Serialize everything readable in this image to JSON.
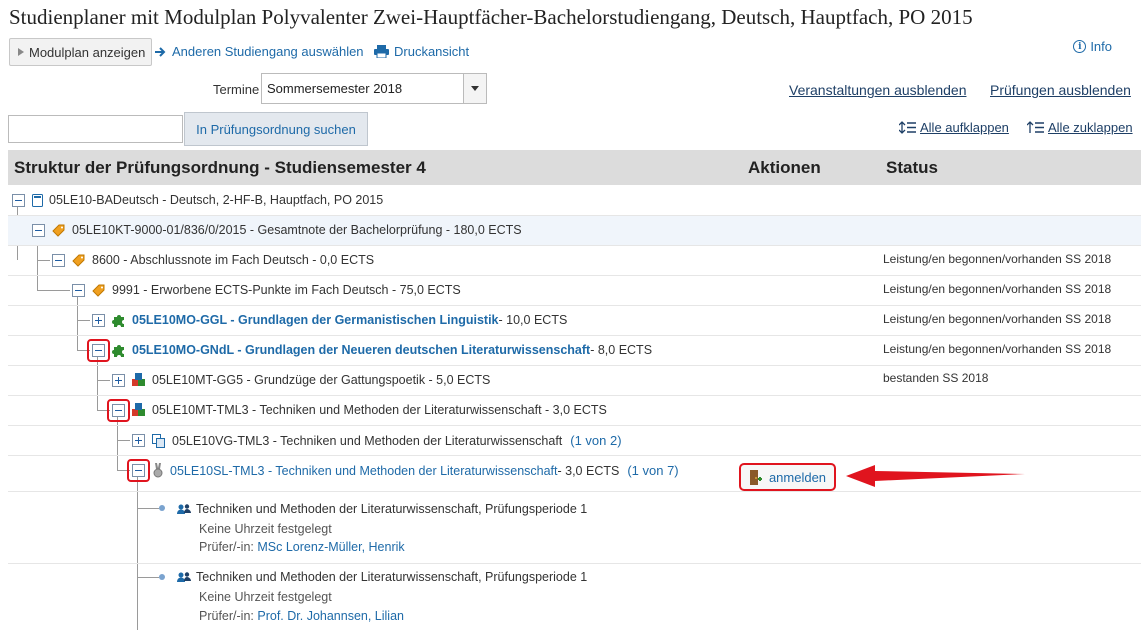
{
  "page_title": "Studienplaner mit Modulplan Polyvalenter Zwei-Hauptfächer-Bachelorstudiengang, Deutsch, Hauptfach, PO 2015",
  "toolbar": {
    "modulplan_label": "Modulplan anzeigen",
    "change_program_label": "Anderen Studiengang auswählen",
    "print_label": "Druckansicht",
    "info_label": "Info"
  },
  "termine": {
    "label": "Termine",
    "selected": "Sommersemester 2018"
  },
  "view_links": {
    "hide_courses": "Veranstaltungen ausblenden",
    "hide_exams": "Prüfungen ausblenden"
  },
  "search": {
    "value": "",
    "button_label": "In Prüfungsordnung suchen"
  },
  "expand": {
    "expand_all": "Alle aufklappen",
    "collapse_all": "Alle zuklappen"
  },
  "table_header": {
    "structure": "Struktur der Prüfungsordnung - Studiensemester 4",
    "actions": "Aktionen",
    "status": "Status"
  },
  "tree": [
    {
      "text": "05LE10-BADeutsch - Deutsch, 2-HF-B, Hauptfach, PO 2015",
      "status": ""
    },
    {
      "text": "05LE10KT-9000-01/836/0/2015 - Gesamtnote der Bachelorprüfung - 180,0 ECTS",
      "status": ""
    },
    {
      "text": "8600 - Abschlussnote im Fach Deutsch - 0,0 ECTS",
      "status": "Leistung/en begonnen/vorhanden   SS 2018"
    },
    {
      "text": "9991 - Erworbene ECTS-Punkte im Fach Deutsch - 75,0 ECTS",
      "status": "Leistung/en begonnen/vorhanden   SS 2018"
    },
    {
      "link": "05LE10MO-GGL - Grundlagen der Germanistischen Linguistik",
      "text": " - 10,0 ECTS",
      "status": "Leistung/en begonnen/vorhanden   SS 2018"
    },
    {
      "link": "05LE10MO-GNdL - Grundlagen der Neueren deutschen Literaturwissenschaft",
      "text": " - 8,0 ECTS",
      "status": "Leistung/en begonnen/vorhanden   SS 2018"
    },
    {
      "text": "05LE10MT-GG5 - Grundzüge der Gattungspoetik - 5,0 ECTS",
      "status": "bestanden   SS 2018"
    },
    {
      "text": "05LE10MT-TML3 - Techniken und Methoden der Literaturwissenschaft - 3,0 ECTS",
      "status": ""
    },
    {
      "text": "05LE10VG-TML3 - Techniken und Methoden der Literaturwissenschaft",
      "pager": "(1 von 2)",
      "status": ""
    },
    {
      "link": "05LE10SL-TML3 - Techniken und Methoden der Literaturwissenschaft",
      "text": " - 3,0 ECTS",
      "pager": "(1 von 7)",
      "status": "",
      "action": "anmelden"
    }
  ],
  "exams": [
    {
      "title": "Techniken und Methoden der Literaturwissenschaft, Prüfungsperiode 1",
      "time": "Keine Uhrzeit festgelegt",
      "examiner_label": "Prüfer/-in:",
      "examiner": "MSc Lorenz-Müller, Henrik"
    },
    {
      "title": "Techniken und Methoden der Literaturwissenschaft, Prüfungsperiode 1",
      "time": "Keine Uhrzeit festgelegt",
      "examiner_label": "Prüfer/-in:",
      "examiner": "Prof. Dr. Johannsen, Lilian"
    }
  ],
  "colors": {
    "link": "#1e6aa8",
    "highlight": "#e0141e",
    "header_bg": "#dcdcdc"
  },
  "icons": [
    "play-triangle-icon",
    "arrow-right-icon",
    "printer-icon",
    "info-icon",
    "expand-all-icon",
    "collapse-all-icon",
    "book-icon",
    "tag-icon",
    "puzzle-icon",
    "cubes-icon",
    "copy-icon",
    "medal-icon",
    "door-enter-icon",
    "people-icon",
    "red-arrow-icon"
  ]
}
